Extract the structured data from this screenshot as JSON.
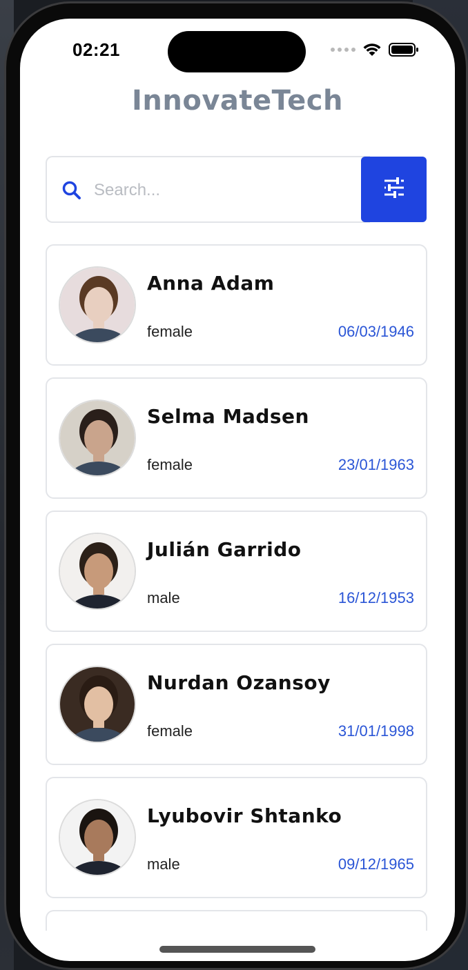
{
  "status_bar": {
    "time": "02:21"
  },
  "app": {
    "title": "InnovateTech"
  },
  "search": {
    "placeholder": "Search..."
  },
  "colors": {
    "accent": "#1f44e0",
    "date": "#2a55d6",
    "title": "#7a8696"
  },
  "icons": {
    "search": "search-icon",
    "filter": "sliders-icon"
  },
  "users": [
    {
      "name": "Anna Adam",
      "gender": "female",
      "dob": "06/03/1946",
      "avatar_tone": "#e8cfc0",
      "hair": "#5a3a24",
      "bg": "#e7dcdd"
    },
    {
      "name": "Selma Madsen",
      "gender": "female",
      "dob": "23/01/1963",
      "avatar_tone": "#c9a48c",
      "hair": "#2a1f1a",
      "bg": "#d6d1c8"
    },
    {
      "name": "Julián Garrido",
      "gender": "male",
      "dob": "16/12/1953",
      "avatar_tone": "#c79a7a",
      "hair": "#2b2018",
      "bg": "#f2f0ee"
    },
    {
      "name": "Nurdan Ozansoy",
      "gender": "female",
      "dob": "31/01/1998",
      "avatar_tone": "#e2bfa3",
      "hair": "#2a1c14",
      "bg": "#3a2b22"
    },
    {
      "name": "Lyubovir Shtanko",
      "gender": "male",
      "dob": "09/12/1965",
      "avatar_tone": "#a87a5c",
      "hair": "#1a1410",
      "bg": "#f3f3f3"
    }
  ]
}
